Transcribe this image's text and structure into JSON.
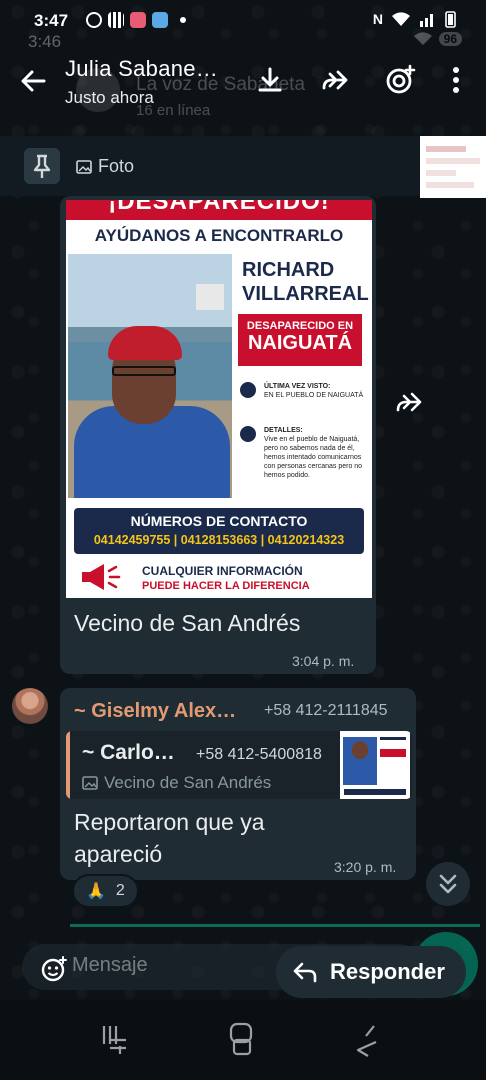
{
  "status": {
    "time": "3:47",
    "ghost_time": "3:46",
    "ghost_battery": "96"
  },
  "header": {
    "title": "Julia Sabane…",
    "subtitle": "Justo ahora",
    "ghost_group": "La voz de Sabaneta",
    "ghost_group_sub": "16 en línea"
  },
  "pinned": {
    "label": "Foto"
  },
  "poster": {
    "banner": "¡DESAPARECIDO!",
    "subtitle": "AYÚDANOS A ENCONTRARLO",
    "name_line1": "RICHARD",
    "name_line2": "VILLARREAL",
    "missing_label": "DESAPARECIDO EN",
    "missing_place": "NAIGUATÁ",
    "last_seen_title": "ÚLTIMA VEZ VISTO:",
    "last_seen_text": "EN EL PUEBLO DE NAIGUATÁ",
    "details_title": "DETALLES:",
    "details_text": "Vive en el pueblo de Naiguatá, pero no sabemos nada de él, hemos intentado comunicarnos con personas cercanas pero no hemos podido.",
    "contact_title": "NÚMEROS DE CONTACTO",
    "contact_numbers": "04142459755  |  04128153663  |  04120214323",
    "info_line1": "CUALQUIER INFORMACIÓN",
    "info_line2": "PUEDE HACER LA DIFERENCIA"
  },
  "message1": {
    "caption": "Vecino de San Andrés",
    "time": "3:04 p. m."
  },
  "message2": {
    "sender": "~ Giselmy Alex…",
    "sender_phone": "+58 412-2111845",
    "quoted_sender": "~ Carlo…",
    "quoted_phone": "+58 412-5400818",
    "quoted_caption": "Vecino de San Andrés",
    "text": "Reportaron que ya apareció",
    "time": "3:20 p. m.",
    "reaction_emoji": "🙏",
    "reaction_count": "2"
  },
  "composer": {
    "placeholder": "Mensaje",
    "reply_label": "Responder"
  },
  "colors": {
    "accent": "#00a884",
    "bubble": "#1f2c34",
    "sender_name": "#e39a73",
    "poster_red": "#c8102e",
    "poster_navy": "#1b2a4a"
  }
}
